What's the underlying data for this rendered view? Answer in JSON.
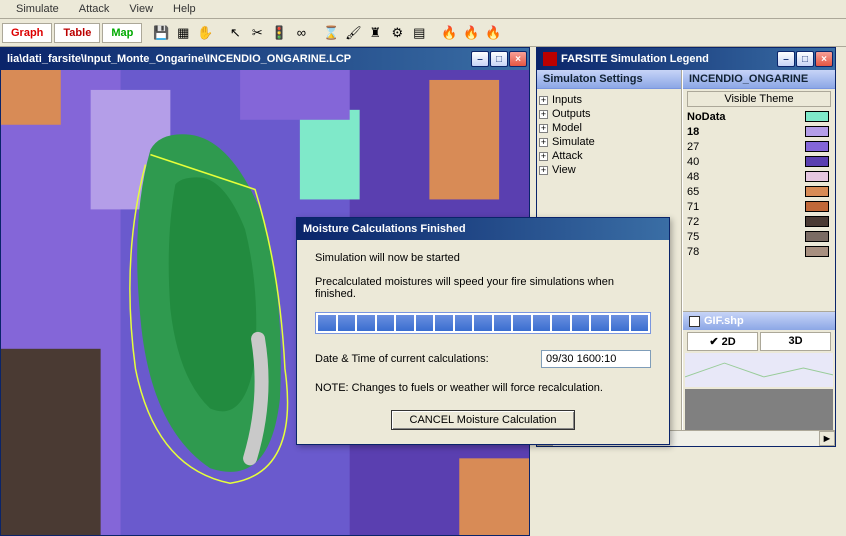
{
  "menu": {
    "items": [
      "Simulate",
      "Attack",
      "View",
      "Help"
    ]
  },
  "tabs": {
    "graph": "Graph",
    "table": "Table",
    "map": "Map"
  },
  "mapwin": {
    "title": "lia\\dati_farsite\\Input_Monte_Ongarine\\INCENDIO_ONGARINE.LCP"
  },
  "legendwin": {
    "title": "FARSITE Simulation Legend",
    "settings_header": "Simulaton Settings",
    "tree": [
      "Inputs",
      "Outputs",
      "Model",
      "Simulate",
      "Attack",
      "View"
    ],
    "theme_header": "INCENDIO_ONGARINE",
    "visible_theme_label": "Visible Theme",
    "themes": [
      {
        "label": "NoData",
        "color": "#7fe9c9",
        "bold": true
      },
      {
        "label": "18",
        "color": "#b49ee8",
        "bold": true
      },
      {
        "label": "27",
        "color": "#8466d8",
        "bold": false
      },
      {
        "label": "40",
        "color": "#5a3fb0",
        "bold": false
      },
      {
        "label": "48",
        "color": "#e6c7e0",
        "bold": false
      },
      {
        "label": "65",
        "color": "#d88b56",
        "bold": false
      },
      {
        "label": "71",
        "color": "#c06838",
        "bold": false
      },
      {
        "label": "72",
        "color": "#4a3a33",
        "bold": false
      },
      {
        "label": "75",
        "color": "#7a6b63",
        "bold": false
      },
      {
        "label": "78",
        "color": "#a78f7f",
        "bold": false
      }
    ],
    "gif_label": "GIF.shp",
    "dim2d": "2D",
    "dim3d": "3D"
  },
  "dialog": {
    "title": "Moisture Calculations Finished",
    "line1": "Simulation will now be started",
    "line2": "Precalculated moistures will speed your fire simulations when finished.",
    "dt_label": "Date & Time of current calculations:",
    "dt_value": "09/30 1600:10",
    "note": "NOTE: Changes to fuels or weather will force recalculation.",
    "cancel": "CANCEL Moisture Calculation",
    "segments": 17
  },
  "icons": {
    "minimize": "–",
    "maximize": "□",
    "close": "×",
    "expand": "+",
    "left": "◄",
    "right": "►"
  }
}
